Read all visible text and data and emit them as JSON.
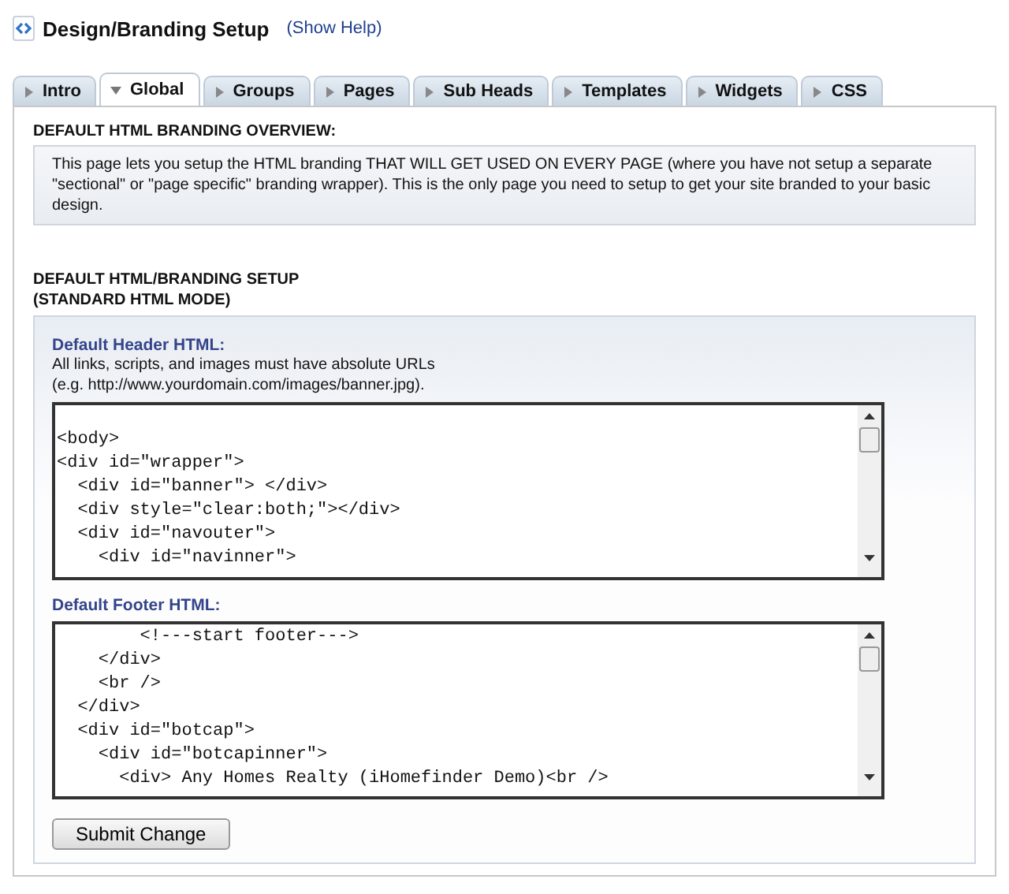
{
  "header": {
    "title": "Design/Branding Setup",
    "help_link": "(Show Help)"
  },
  "tabs": [
    {
      "label": "Intro",
      "selected": false
    },
    {
      "label": "Global",
      "selected": true
    },
    {
      "label": "Groups",
      "selected": false
    },
    {
      "label": "Pages",
      "selected": false
    },
    {
      "label": "Sub Heads",
      "selected": false
    },
    {
      "label": "Templates",
      "selected": false
    },
    {
      "label": "Widgets",
      "selected": false
    },
    {
      "label": "CSS",
      "selected": false
    }
  ],
  "overview": {
    "heading": "DEFAULT HTML BRANDING OVERVIEW:",
    "text": "This page lets you setup the HTML branding THAT WILL GET USED ON EVERY PAGE (where you have not setup a separate \"sectional\" or \"page specific\" branding wrapper). This is the only page you need to setup to get your site branded to your basic design."
  },
  "setup": {
    "heading": [
      "DEFAULT HTML/BRANDING SETUP",
      "(STANDARD HTML MODE)"
    ],
    "header_field": {
      "label": "Default Header HTML:",
      "notes": [
        "All links, scripts, and images must have absolute URLs",
        "(e.g. http://www.yourdomain.com/images/banner.jpg)."
      ],
      "lines": [
        "<body>",
        "<div id=\"wrapper\">",
        "  <div id=\"banner\"> </div>",
        "  <div style=\"clear:both;\"></div>",
        "  <div id=\"navouter\">",
        "    <div id=\"navinner\">"
      ]
    },
    "footer_field": {
      "label": "Default Footer HTML:",
      "lines": [
        "        <!---start footer--->",
        "    </div>",
        "    <br />",
        "  </div>",
        "  <div id=\"botcap\">",
        "    <div id=\"botcapinner\">",
        "      <div> Any Homes Realty (iHomefinder Demo)<br />"
      ]
    },
    "submit": "Submit Change"
  }
}
